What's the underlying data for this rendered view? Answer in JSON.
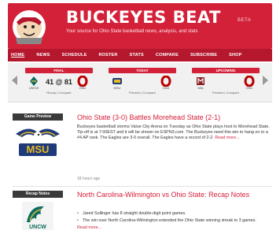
{
  "header": {
    "title": "BUCKEYES BEAT",
    "beta": "BETA",
    "tagline": "Your source for Ohio State basketball news, analysis, and stats"
  },
  "nav": {
    "items": [
      "HOME",
      "NEWS",
      "SCHEDULE",
      "ROSTER",
      "STATS",
      "COMPARE",
      "SUBSCRIBE",
      "SHOP"
    ]
  },
  "scoreboard": {
    "games": [
      {
        "header": "FINAL",
        "home_abbr": "UNCW",
        "away_abbr": "OSU",
        "score": "41 @ 81",
        "links": "Recap | Compare"
      },
      {
        "header": "TODAY",
        "home_abbr": "MSU",
        "away_abbr": "OSU",
        "score": "",
        "links": "Preview | Compare"
      },
      {
        "header": "UPCOMING",
        "home_abbr": "MIA",
        "away_abbr": "OSU",
        "score": "",
        "links": "Preview | Compare"
      }
    ]
  },
  "articles": [
    {
      "label": "Game Preview",
      "logo_text": "MSU",
      "title": "Ohio State (3-0) Battles Morehead State (2-1)",
      "body": "Buckeyes basketball storms Value City Arena on Tuesday as Ohio State plays host to Morehead State. Tip-off is at 7:00EST and it will be shown on ESPN3.com. The Buckeyes need this win to hang on to a #4 AP rank. The Eagles are 3-0 overall. The Eagles have a record of 2-2.",
      "more": "Read more...",
      "meta": "18 hours ago"
    },
    {
      "label": "Recap Notes",
      "logo_text": "UNCW",
      "title": "North Carolina-Wilmington vs Ohio State: Recap Notes",
      "bullets": [
        "Jared Sullinger has 8 straight double-digit point games.",
        "The win over North Carolina-Wilmington extended the Ohio State winning streak to 3 games."
      ],
      "more": "Read more..."
    }
  ],
  "colors": {
    "brand": "#d4213a",
    "nav": "#b5172d",
    "scarlet": "#bb0000",
    "gray": "#666666"
  }
}
